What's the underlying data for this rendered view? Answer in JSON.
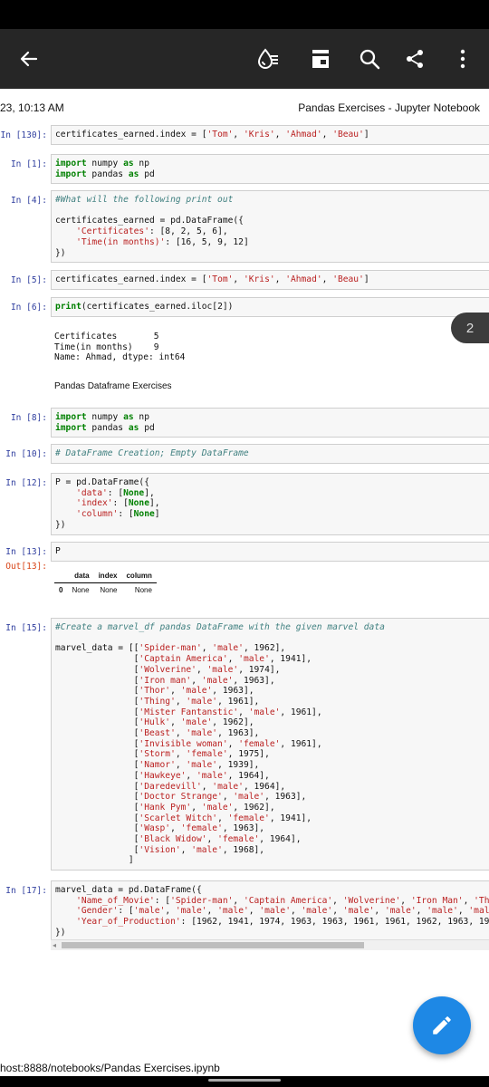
{
  "header": {
    "datetime": "23, 10:13 AM",
    "title": "Pandas Exercises - Jupyter Notebook"
  },
  "appbar_icons": [
    "back-arrow-icon",
    "reader-mode-icon",
    "bookmark-icon",
    "search-icon",
    "share-icon",
    "more-options-icon"
  ],
  "page_badge": "2",
  "cells": {
    "c0": {
      "prompt": "In [130]:"
    },
    "c1": {
      "prompt": "In [1]:"
    },
    "c2": {
      "prompt": "In [4]:"
    },
    "c3": {
      "prompt": "In [5]:"
    },
    "c4": {
      "prompt": "In [6]:",
      "output": "Certificates       5\nTime(in months)    9\nName: Ahmad, dtype: int64"
    },
    "md1": "Pandas Dataframe Exercises",
    "c5": {
      "prompt": "In [8]:"
    },
    "c6": {
      "prompt": "In [10]:"
    },
    "c7": {
      "prompt": "In [12]:"
    },
    "c8": {
      "prompt": "In [13]:",
      "out_prompt": "Out[13]:"
    },
    "df_table": {
      "columns": [
        "data",
        "index",
        "column"
      ],
      "rows": [
        [
          "0",
          "None",
          "None",
          "None"
        ]
      ]
    },
    "c9": {
      "prompt": "In [15]:"
    },
    "c10": {
      "prompt": "In [17]:"
    }
  },
  "footer_url": "host:8888/notebooks/Pandas Exercises.ipynb",
  "colors": {
    "fab": "#1e88e5",
    "appbar": "#262626",
    "prompt_in": "#303f9f",
    "prompt_out": "#d84315"
  }
}
